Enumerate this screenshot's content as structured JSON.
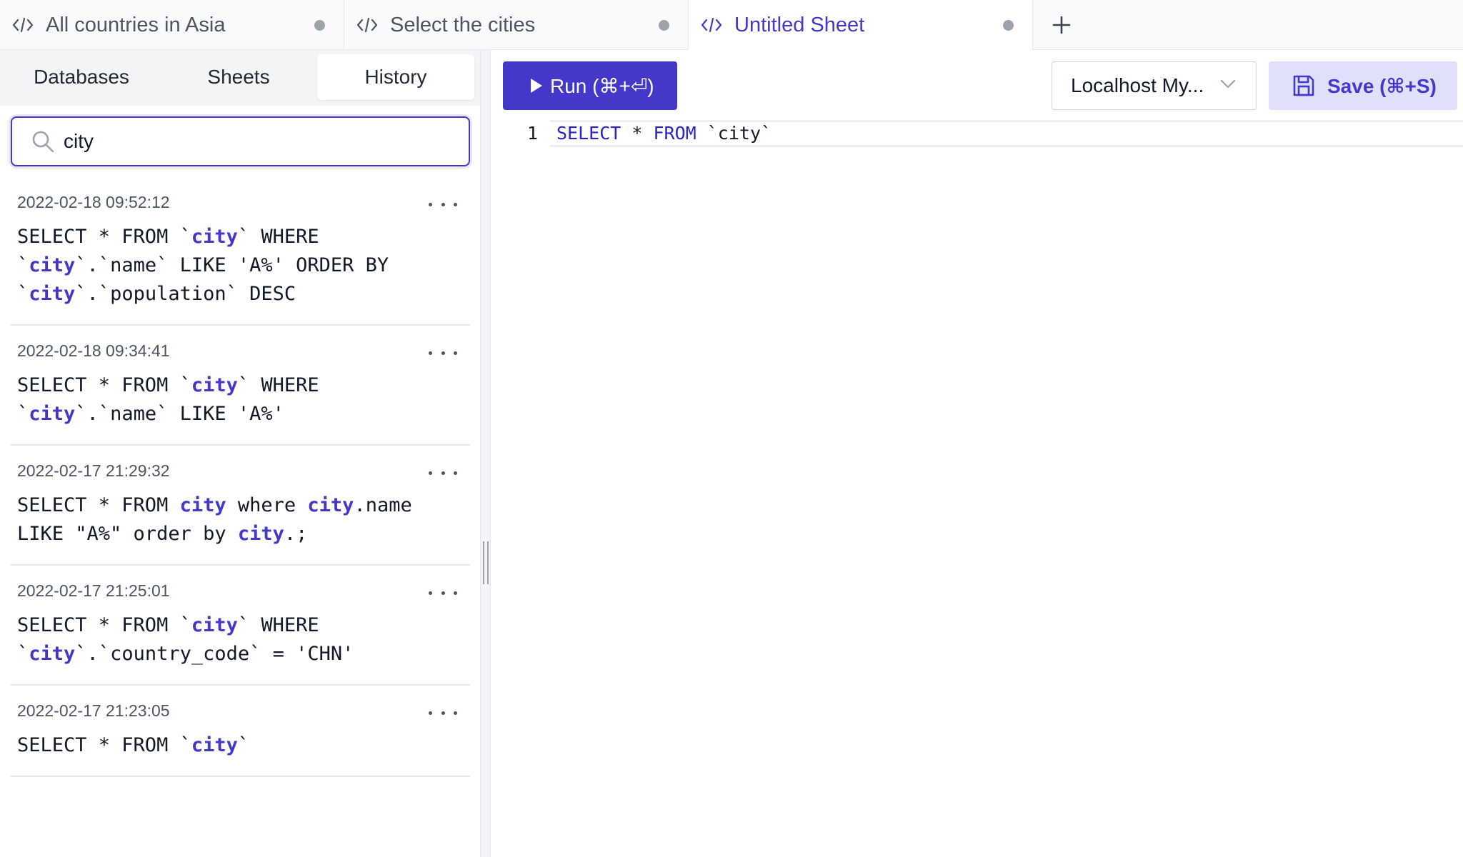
{
  "tabs": [
    {
      "label": "All countries in Asia",
      "active": false
    },
    {
      "label": "Select the cities",
      "active": false
    },
    {
      "label": "Untitled Sheet",
      "active": true
    }
  ],
  "add_tab_symbol": "+",
  "sidebar": {
    "segments": [
      {
        "label": "Databases",
        "active": false
      },
      {
        "label": "Sheets",
        "active": false
      },
      {
        "label": "History",
        "active": true
      }
    ],
    "search": {
      "value": "city",
      "placeholder": ""
    },
    "history": [
      {
        "date": "2022-02-18 09:52:12",
        "lines": [
          [
            {
              "t": "SELECT * FROM `"
            },
            {
              "t": "city",
              "h": true
            },
            {
              "t": "` WHERE"
            }
          ],
          [
            {
              "t": "`"
            },
            {
              "t": "city",
              "h": true
            },
            {
              "t": "`.`name` LIKE 'A%' ORDER BY"
            }
          ],
          [
            {
              "t": "`"
            },
            {
              "t": "city",
              "h": true
            },
            {
              "t": "`.`population` DESC"
            }
          ]
        ]
      },
      {
        "date": "2022-02-18 09:34:41",
        "lines": [
          [
            {
              "t": "SELECT * FROM `"
            },
            {
              "t": "city",
              "h": true
            },
            {
              "t": "` WHERE"
            }
          ],
          [
            {
              "t": "`"
            },
            {
              "t": "city",
              "h": true
            },
            {
              "t": "`.`name` LIKE 'A%'"
            }
          ]
        ]
      },
      {
        "date": "2022-02-17 21:29:32",
        "lines": [
          [
            {
              "t": "SELECT * FROM "
            },
            {
              "t": "city",
              "h": true
            },
            {
              "t": " where "
            },
            {
              "t": "city",
              "h": true
            },
            {
              "t": ".name"
            }
          ],
          [
            {
              "t": "LIKE \"A%\" order by "
            },
            {
              "t": "city",
              "h": true
            },
            {
              "t": ".;"
            }
          ]
        ]
      },
      {
        "date": "2022-02-17 21:25:01",
        "lines": [
          [
            {
              "t": "SELECT * FROM `"
            },
            {
              "t": "city",
              "h": true
            },
            {
              "t": "` WHERE"
            }
          ],
          [
            {
              "t": "`"
            },
            {
              "t": "city",
              "h": true
            },
            {
              "t": "`.`country_code` = 'CHN'"
            }
          ]
        ]
      },
      {
        "date": "2022-02-17 21:23:05",
        "lines": [
          [
            {
              "t": "SELECT * FROM `"
            },
            {
              "t": "city",
              "h": true
            },
            {
              "t": "`"
            }
          ]
        ]
      }
    ]
  },
  "toolbar": {
    "run_label": "Run (⌘+⏎)",
    "connection_label": "Localhost My...",
    "save_label": "Save (⌘+S)"
  },
  "editor": {
    "line_number": "1",
    "tokens": [
      {
        "t": "SELECT",
        "kw": true
      },
      {
        "t": " * ",
        "kw": false
      },
      {
        "t": "FROM",
        "kw": true
      },
      {
        "t": " `city`",
        "kw": false
      }
    ]
  },
  "colors": {
    "accent": "#4338ca",
    "save_bg": "#e0e0fb",
    "tab_dot": "#9ca3af"
  }
}
